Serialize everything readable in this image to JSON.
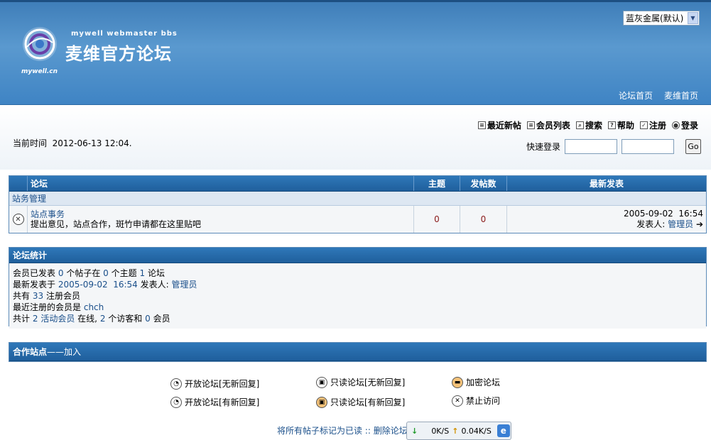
{
  "header": {
    "skin_select": "蓝灰金属(默认)",
    "logo_en": "mywell webmaster bbs",
    "logo_cn": "麦维官方论坛",
    "logo_url": "mywell.cn",
    "links": [
      "论坛首页",
      "麦维首页"
    ]
  },
  "toplinks": [
    {
      "label": "最近新帖",
      "icon": "list-icon"
    },
    {
      "label": "会员列表",
      "icon": "list-icon"
    },
    {
      "label": "搜索",
      "icon": "search-icon"
    },
    {
      "label": "帮助",
      "icon": "help-icon"
    },
    {
      "label": "注册",
      "icon": "check-icon"
    },
    {
      "label": "登录",
      "icon": "login-icon"
    }
  ],
  "current_time": {
    "label": "当前时间",
    "value": "2012-06-13 12:04."
  },
  "quick_login": {
    "label": "快速登录",
    "go": "Go"
  },
  "forum_table": {
    "headers": [
      "论坛",
      "主题",
      "发帖数",
      "最新发表"
    ],
    "category": "站务管理",
    "rows": [
      {
        "name": "站点事务",
        "desc": "提出意见，站点合作，斑竹申请都在这里贴吧",
        "topics": "0",
        "posts": "0",
        "last_date": "2005-09-02",
        "last_time": "16:54",
        "poster_label": "发表人:",
        "poster": "管理员"
      }
    ]
  },
  "stats": {
    "title": "论坛统计",
    "line1": {
      "a": "会员已发表",
      "posts": "0",
      "b": "个帖子在",
      "topics": "0",
      "c": "个主题",
      "forums": "1",
      "d": "论坛"
    },
    "line2": {
      "a": "最新发表于",
      "date": "2005-09-02",
      "time": "16:54",
      "b": "发表人:",
      "poster": "管理员"
    },
    "line3": {
      "a": "共有",
      "count": "33",
      "b": "注册会员"
    },
    "line4": {
      "a": "最近注册的会员是",
      "member": "chch"
    },
    "line5": {
      "a": "共计",
      "active": "2",
      "link": "活动会员",
      "b": "在线,",
      "guests": "2",
      "c": "个访客和",
      "members": "0",
      "d": "会员"
    }
  },
  "partner": {
    "title": "合作站点",
    "link": "——加入"
  },
  "legend": [
    {
      "label": "开放论坛[无新回复]",
      "icon": "open-forum-icon"
    },
    {
      "label": "只读论坛[无新回复]",
      "icon": "lock-icon"
    },
    {
      "label": "加密论坛",
      "icon": "encrypted-icon"
    },
    {
      "label": "开放论坛[有新回复]",
      "icon": "open-forum-new-icon"
    },
    {
      "label": "只读论坛[有新回复]",
      "icon": "lock-new-icon"
    },
    {
      "label": "禁止访问",
      "icon": "forbidden-icon"
    }
  ],
  "footer": {
    "mark_read": "将所有帖子标记为已读",
    "sep": "::",
    "delete_cookie": "删除论坛"
  },
  "speedbar": {
    "down": "0K/S",
    "up": "0.04K/S"
  }
}
